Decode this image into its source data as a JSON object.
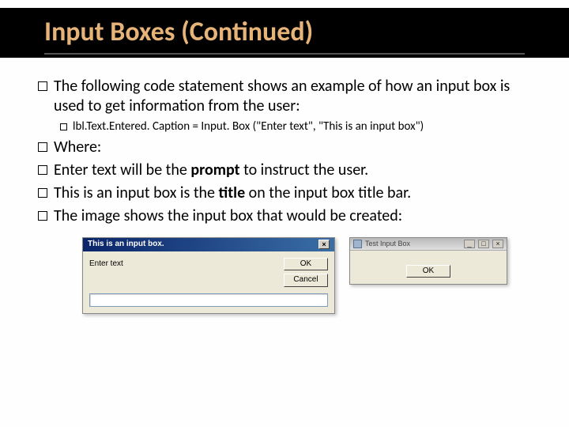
{
  "slide": {
    "title": "Input Boxes (Continued)",
    "bullets": {
      "b1": "The following code statement shows an example of how an input box is used to get information from the user:",
      "code": "lbl.Text.Entered. Caption = Input. Box (\"Enter text\", \"This is an input box\")",
      "b2": "Where:",
      "b3_pre": "Enter text will be the ",
      "b3_bold": "prompt",
      "b3_post": " to instruct the user.",
      "b4_pre": "This is an input box is the ",
      "b4_bold": "title",
      "b4_post": " on the input box title bar.",
      "b5": "The image shows the input box that would be created:"
    }
  },
  "dialog1": {
    "title": "This is an input box.",
    "prompt": "Enter text",
    "ok": "OK",
    "cancel": "Cancel",
    "close_glyph": "×"
  },
  "dialog2": {
    "title": "Test Input Box",
    "ok": "OK",
    "min": "_",
    "max": "□",
    "close": "×"
  }
}
